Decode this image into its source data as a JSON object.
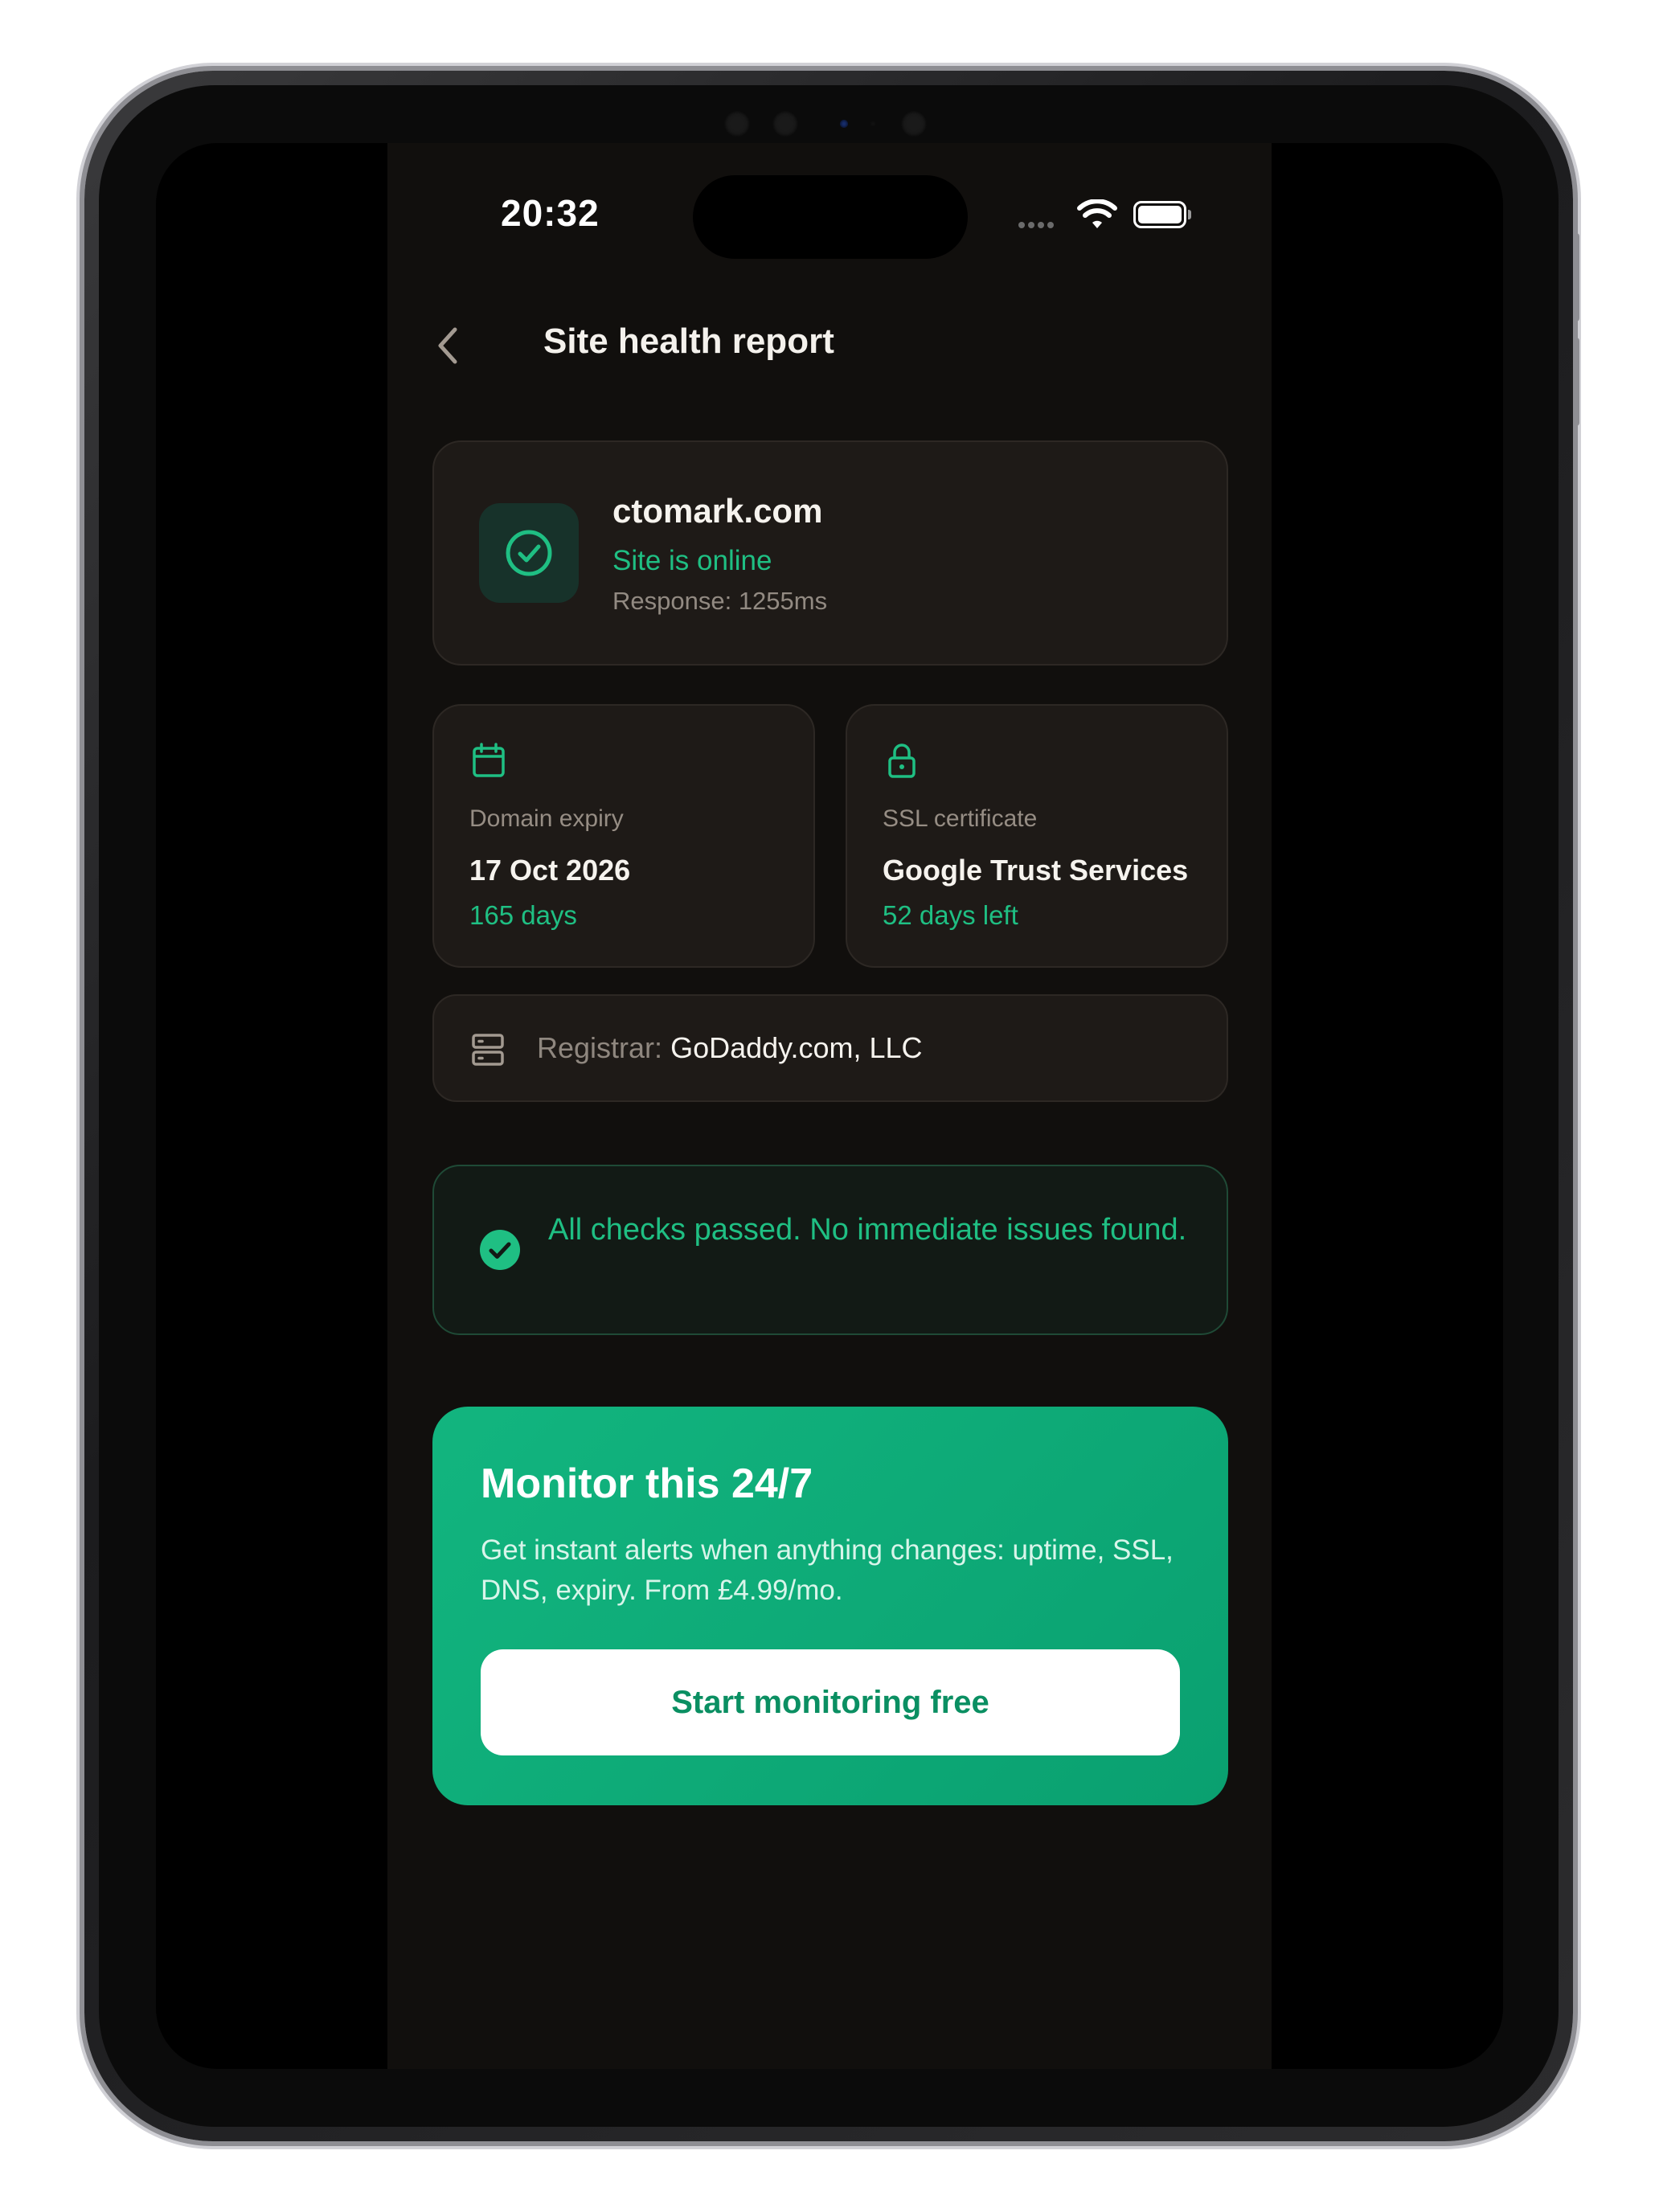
{
  "status_bar": {
    "time": "20:32"
  },
  "header": {
    "title": "Site health report"
  },
  "site": {
    "domain": "ctomark.com",
    "status": "Site is online",
    "response": "Response: 1255ms"
  },
  "domain_expiry": {
    "label": "Domain expiry",
    "date": "17 Oct 2026",
    "remaining": "165 days"
  },
  "ssl": {
    "label": "SSL certificate",
    "issuer": "Google Trust Services",
    "remaining": "52 days left"
  },
  "registrar": {
    "label": "Registrar:",
    "value": "GoDaddy.com, LLC"
  },
  "checks": {
    "message": "All checks passed. No immediate issues found."
  },
  "cta": {
    "title": "Monitor this 24/7",
    "description": "Get instant alerts when anything changes: uptime, SSL, DNS, expiry. From £4.99/mo.",
    "button_label": "Start monitoring free"
  },
  "colors": {
    "background": "#110f0d",
    "card": "#1e1a17",
    "accent_green": "#1fbf83",
    "cta_green": "#12b57f"
  },
  "icons": {
    "back": "chevron-left-icon",
    "site_status": "check-circle-icon",
    "domain_expiry": "calendar-icon",
    "ssl": "lock-icon",
    "registrar": "server-icon",
    "checks": "check-circle-filled-icon"
  }
}
